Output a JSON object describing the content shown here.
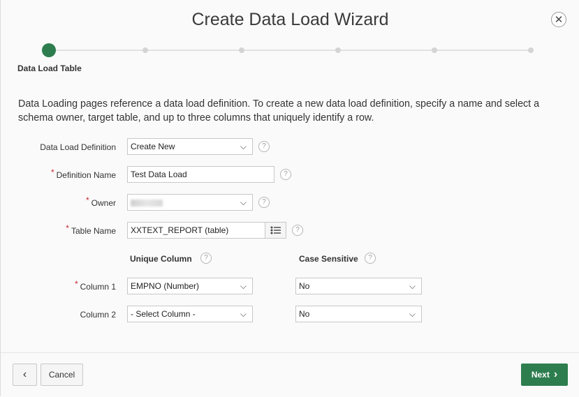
{
  "dialog": {
    "title": "Create Data Load Wizard",
    "close_icon": "close-icon"
  },
  "wizard": {
    "current_step_label": "Data Load Table",
    "total_steps": 6,
    "current_step": 1
  },
  "intro": "Data Loading pages reference a data load definition. To create a new data load definition, specify a name and select a schema owner, target table, and up to three columns that uniquely identify a row.",
  "form": {
    "data_load_definition": {
      "label": "Data Load Definition",
      "value": "Create New"
    },
    "definition_name": {
      "label": "Definition Name",
      "value": "Test Data Load"
    },
    "owner": {
      "label": "Owner",
      "value": ""
    },
    "table_name": {
      "label": "Table Name",
      "value": "XXTEXT_REPORT (table)"
    },
    "unique_column_header": "Unique Column",
    "case_sensitive_header": "Case Sensitive",
    "column1": {
      "label": "Column 1",
      "value": "EMPNO (Number)",
      "case_value": "No"
    },
    "column2": {
      "label": "Column 2",
      "value": "- Select Column -",
      "case_value": "No"
    },
    "required_mark": "*",
    "help_glyph": "?"
  },
  "footer": {
    "back_icon": "chevron-left-icon",
    "back_glyph": "‹",
    "cancel_label": "Cancel",
    "next_label": "Next",
    "next_glyph": "›"
  },
  "colors": {
    "accent": "#2e7d4f",
    "required": "#c6262e"
  }
}
